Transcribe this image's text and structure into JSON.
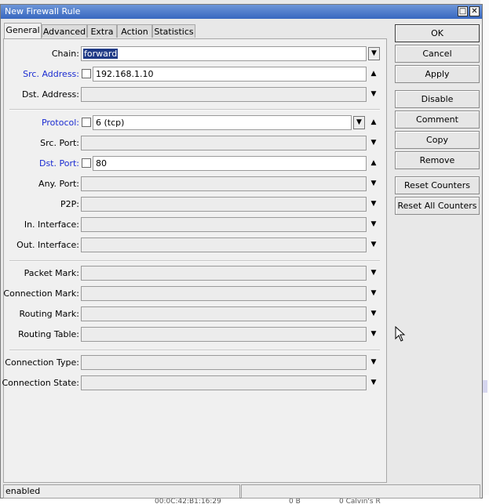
{
  "window": {
    "title": "New Firewall Rule",
    "maximize_glyph": "□",
    "close_glyph": "✕"
  },
  "tabs": [
    {
      "label": "General",
      "active": true
    },
    {
      "label": "Advanced"
    },
    {
      "label": "Extra"
    },
    {
      "label": "Action"
    },
    {
      "label": "Statistics"
    }
  ],
  "fields": {
    "chain": {
      "label": "Chain:",
      "value": "forward"
    },
    "src_address": {
      "label": "Src. Address:",
      "value": "192.168.1.10"
    },
    "dst_address": {
      "label": "Dst. Address:",
      "value": ""
    },
    "protocol": {
      "label": "Protocol:",
      "value": "6 (tcp)"
    },
    "src_port": {
      "label": "Src. Port:",
      "value": ""
    },
    "dst_port": {
      "label": "Dst. Port:",
      "value": "80"
    },
    "any_port": {
      "label": "Any. Port:",
      "value": ""
    },
    "p2p": {
      "label": "P2P:",
      "value": ""
    },
    "in_interface": {
      "label": "In. Interface:",
      "value": ""
    },
    "out_interface": {
      "label": "Out. Interface:",
      "value": ""
    },
    "packet_mark": {
      "label": "Packet Mark:",
      "value": ""
    },
    "connection_mark": {
      "label": "Connection Mark:",
      "value": ""
    },
    "routing_mark": {
      "label": "Routing Mark:",
      "value": ""
    },
    "routing_table": {
      "label": "Routing Table:",
      "value": ""
    },
    "connection_type": {
      "label": "Connection Type:",
      "value": ""
    },
    "connection_state": {
      "label": "Connection State:",
      "value": ""
    }
  },
  "buttons": {
    "ok": "OK",
    "cancel": "Cancel",
    "apply": "Apply",
    "disable": "Disable",
    "comment": "Comment",
    "copy": "Copy",
    "remove": "Remove",
    "reset_counters": "Reset Counters",
    "reset_all_counters": "Reset All Counters"
  },
  "status": {
    "text": "enabled"
  },
  "background": {
    "row_time": "00:0C:42:B1:16:29",
    "row_value": "0 B",
    "row_name": "0 Calvin's R"
  },
  "icons": {
    "dropdown": "triangle-down",
    "expand": "triangle-up",
    "collapse": "triangle-down"
  }
}
